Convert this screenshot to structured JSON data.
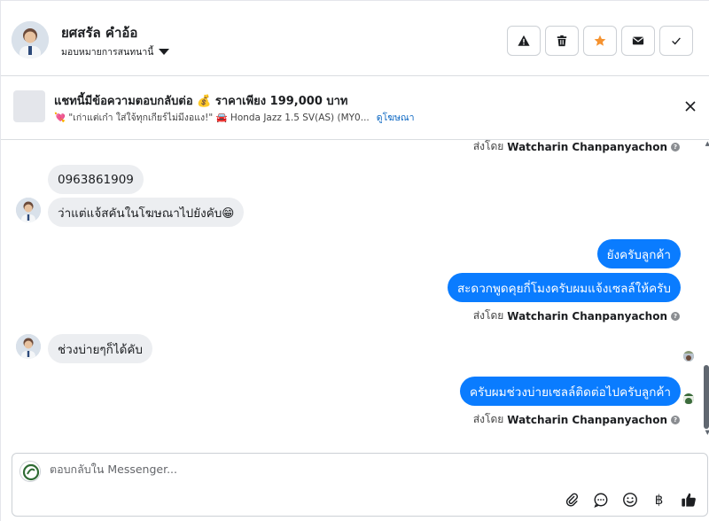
{
  "header": {
    "contact_name": "ยศสรัล คำอ้อ",
    "assign_label": "มอบหมายการสนทนานี้",
    "actions": [
      {
        "name": "report-spam-button",
        "icon": "warning-icon"
      },
      {
        "name": "delete-button",
        "icon": "trash-icon"
      },
      {
        "name": "star-button",
        "icon": "star-icon"
      },
      {
        "name": "mark-unread-button",
        "icon": "envelope-icon"
      },
      {
        "name": "mark-done-button",
        "icon": "check-icon"
      }
    ]
  },
  "ad_banner": {
    "title": "แชทนี้มีข้อความตอบกลับต่อ 💰 ราคาเพียง 199,000 บาท",
    "subtitle": "💘 \"เก่าแต่เก๋า ใส่ใจ้ทุกเกียร์ไม่มีงอแง!\" 🚘 Honda Jazz 1.5 SV(AS) (MY0...",
    "link": "ดูโฆษณา"
  },
  "messages": {
    "sent_by_prefix": "ส่งโดย",
    "agent_name": "Watcharin Chanpanyachon",
    "in_1": "0963861909",
    "in_2": "ว่าแต่แจ้สคันในโฆษณาไปยังคับ😁",
    "out_1": "ยังครับลูกค้า",
    "out_2": "สะดวกพูดคุยกี่โมงครับผมแจ้งเซลล์ให้ครับ",
    "in_3": "ช่วงบ่ายๆก็ได้คับ",
    "out_3": "ครับผมช่วงบ่ายเซลล์ติดต่อไปครับลูกค้า"
  },
  "composer": {
    "placeholder": "ตอบกลับใน Messenger...",
    "currency_symbol": "฿"
  },
  "colors": {
    "outgoing_bubble": "#0a7cff",
    "incoming_bubble": "#eceef1",
    "star": "#f5922f"
  }
}
